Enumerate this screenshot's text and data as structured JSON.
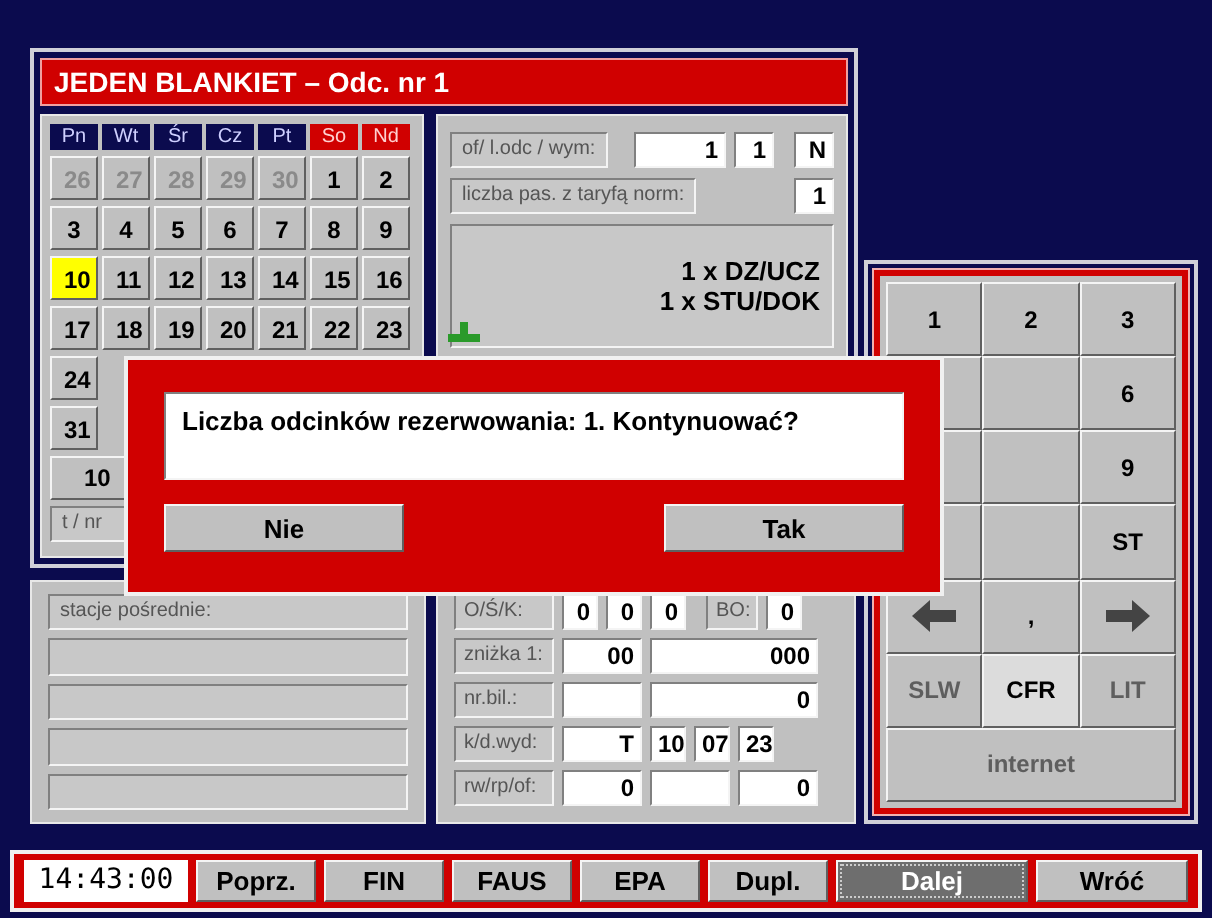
{
  "window": {
    "title": "JEDEN BLANKIET – Odc. nr 1"
  },
  "calendar": {
    "weekdays": [
      {
        "label": "Pn",
        "weekend": false
      },
      {
        "label": "Wt",
        "weekend": false
      },
      {
        "label": "Śr",
        "weekend": false
      },
      {
        "label": "Cz",
        "weekend": false
      },
      {
        "label": "Pt",
        "weekend": false
      },
      {
        "label": "So",
        "weekend": true
      },
      {
        "label": "Nd",
        "weekend": true
      }
    ],
    "weeks": [
      [
        {
          "label": "26",
          "muted": true,
          "selected": false
        },
        {
          "label": "27",
          "muted": true,
          "selected": false
        },
        {
          "label": "28",
          "muted": true,
          "selected": false
        },
        {
          "label": "29",
          "muted": true,
          "selected": false
        },
        {
          "label": "30",
          "muted": true,
          "selected": false
        },
        {
          "label": "1",
          "muted": false,
          "selected": false
        },
        {
          "label": "2",
          "muted": false,
          "selected": false
        }
      ],
      [
        {
          "label": "3",
          "muted": false,
          "selected": false
        },
        {
          "label": "4",
          "muted": false,
          "selected": false
        },
        {
          "label": "5",
          "muted": false,
          "selected": false
        },
        {
          "label": "6",
          "muted": false,
          "selected": false
        },
        {
          "label": "7",
          "muted": false,
          "selected": false
        },
        {
          "label": "8",
          "muted": false,
          "selected": false
        },
        {
          "label": "9",
          "muted": false,
          "selected": false
        }
      ],
      [
        {
          "label": "10",
          "muted": false,
          "selected": true
        },
        {
          "label": "11",
          "muted": false,
          "selected": false
        },
        {
          "label": "12",
          "muted": false,
          "selected": false
        },
        {
          "label": "13",
          "muted": false,
          "selected": false
        },
        {
          "label": "14",
          "muted": false,
          "selected": false
        },
        {
          "label": "15",
          "muted": false,
          "selected": false
        },
        {
          "label": "16",
          "muted": false,
          "selected": false
        }
      ],
      [
        {
          "label": "17",
          "muted": false,
          "selected": false
        },
        {
          "label": "18",
          "muted": false,
          "selected": false
        },
        {
          "label": "19",
          "muted": false,
          "selected": false
        },
        {
          "label": "20",
          "muted": false,
          "selected": false
        },
        {
          "label": "21",
          "muted": false,
          "selected": false
        },
        {
          "label": "22",
          "muted": false,
          "selected": false
        },
        {
          "label": "23",
          "muted": false,
          "selected": false
        }
      ],
      [
        {
          "label": "24",
          "muted": false,
          "selected": false
        }
      ],
      [
        {
          "label": "31",
          "muted": false,
          "selected": false
        }
      ]
    ],
    "date_button": "10",
    "field_label": "t / nr"
  },
  "ticket": {
    "rows": [
      {
        "label": "of/ l.odc / wym:",
        "values": [
          "1",
          "1",
          "N"
        ]
      },
      {
        "label": "liczba pas. z taryfą norm:",
        "values": [
          "1"
        ]
      }
    ],
    "summary": [
      "1 x DZ/UCZ",
      "1 x STU/DOK"
    ]
  },
  "keypad": {
    "rows": [
      [
        "1",
        "2",
        "3"
      ],
      [
        "6"
      ],
      [
        "9"
      ],
      [
        "ST"
      ]
    ],
    "arrows": [
      {
        "kind": "left"
      },
      {
        "kind": "text",
        "label": ","
      },
      {
        "kind": "right"
      }
    ],
    "carriers": [
      {
        "label": "SLW",
        "disabled": true,
        "selected": false
      },
      {
        "label": "CFR",
        "disabled": false,
        "selected": true
      },
      {
        "label": "LIT",
        "disabled": true,
        "selected": false
      }
    ],
    "internet": {
      "label": "internet",
      "disabled": true
    }
  },
  "stations": {
    "label": "stacje pośrednie:"
  },
  "details": [
    {
      "label": "O/Ś/K:",
      "fields": [
        {
          "kind": "digit",
          "value": "0"
        },
        {
          "kind": "digit",
          "value": "0"
        },
        {
          "kind": "digit",
          "value": "0"
        },
        {
          "kind": "label",
          "label": "BO:"
        },
        {
          "kind": "digit",
          "value": "0"
        }
      ]
    },
    {
      "label": "zniżka 1:",
      "fields": [
        {
          "kind": "short",
          "value": "00"
        },
        {
          "kind": "long",
          "value": "000"
        }
      ]
    },
    {
      "label": "nr.bil.:",
      "fields": [
        {
          "kind": "short"
        },
        {
          "kind": "long",
          "value": "0"
        }
      ]
    },
    {
      "label": "k/d.wyd:",
      "fields": [
        {
          "kind": "short",
          "value": "T"
        },
        {
          "kind": "digit",
          "value": "10"
        },
        {
          "kind": "digit",
          "value": "07"
        },
        {
          "kind": "digit",
          "value": "23"
        }
      ]
    },
    {
      "label": "rw/rp/of:",
      "fields": [
        {
          "kind": "short",
          "value": "0"
        },
        {
          "kind": "mid"
        },
        {
          "kind": "mid",
          "value": "0"
        }
      ]
    }
  ],
  "bottom_bar": {
    "clock": "14:43:00",
    "buttons": [
      {
        "label": "Poprz.",
        "selected": false
      },
      {
        "label": "FIN",
        "selected": false
      },
      {
        "label": "FAUS",
        "selected": false
      },
      {
        "label": "EPA",
        "selected": false
      },
      {
        "label": "Dupl.",
        "selected": false
      },
      {
        "label": "Dalej",
        "selected": true
      },
      {
        "label": "Wróć",
        "selected": false
      }
    ]
  },
  "dialog": {
    "message": "Liczba odcinków rezerwowania: 1. Kontynuować?",
    "buttons": [
      "Nie",
      "Tak"
    ]
  }
}
